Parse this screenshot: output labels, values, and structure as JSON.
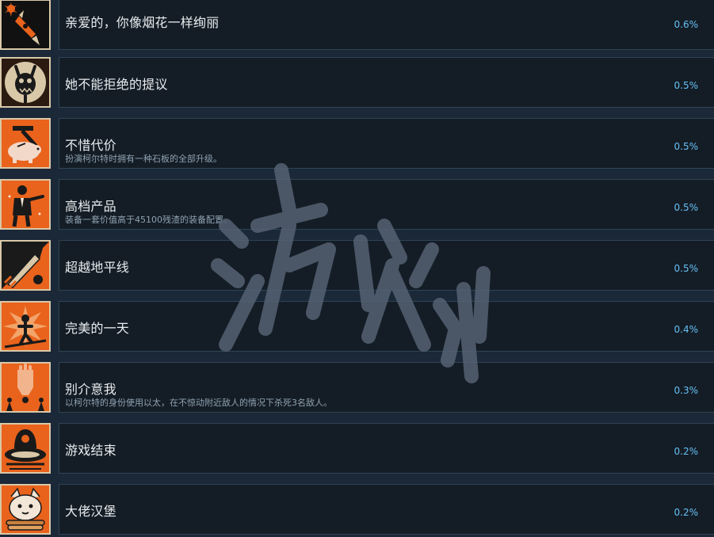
{
  "achievements": [
    {
      "title": "亲爱的，你像烟花一样绚丽",
      "description": "",
      "percent": "0.6%",
      "icon": "firework-rocket-icon"
    },
    {
      "title": "她不能拒绝的提议",
      "description": "",
      "percent": "0.5%",
      "icon": "monster-creature-icon"
    },
    {
      "title": "不惜代价",
      "description": "扮演柯尔特时拥有一种石板的全部升级。",
      "percent": "0.5%",
      "icon": "hammer-piggy-bank-icon"
    },
    {
      "title": "高档产品",
      "description": "装备一套价值高于45100残渣的装备配置。",
      "percent": "0.5%",
      "icon": "tuxedo-man-icon"
    },
    {
      "title": "超越地平线",
      "description": "",
      "percent": "0.5%",
      "icon": "rocket-launch-icon"
    },
    {
      "title": "完美的一天",
      "description": "",
      "percent": "0.4%",
      "icon": "explosion-figure-icon"
    },
    {
      "title": "别介意我",
      "description": "以柯尔特的身份使用以太，在不惊动附近敌人的情况下杀死3名敌人。",
      "percent": "0.3%",
      "icon": "ghost-hand-icon"
    },
    {
      "title": "游戏结束",
      "description": "",
      "percent": "0.2%",
      "icon": "spaceship-pilot-icon"
    },
    {
      "title": "大佬汉堡",
      "description": "",
      "percent": "0.2%",
      "icon": "burger-face-icon"
    }
  ],
  "colors": {
    "background": "#1b2838",
    "panel": "#141d26",
    "panel_border": "#2f4454",
    "icon_orange": "#e9631c",
    "icon_cream": "#d9c8a8",
    "percent": "#66c0f4"
  },
  "watermark": "游侠网"
}
